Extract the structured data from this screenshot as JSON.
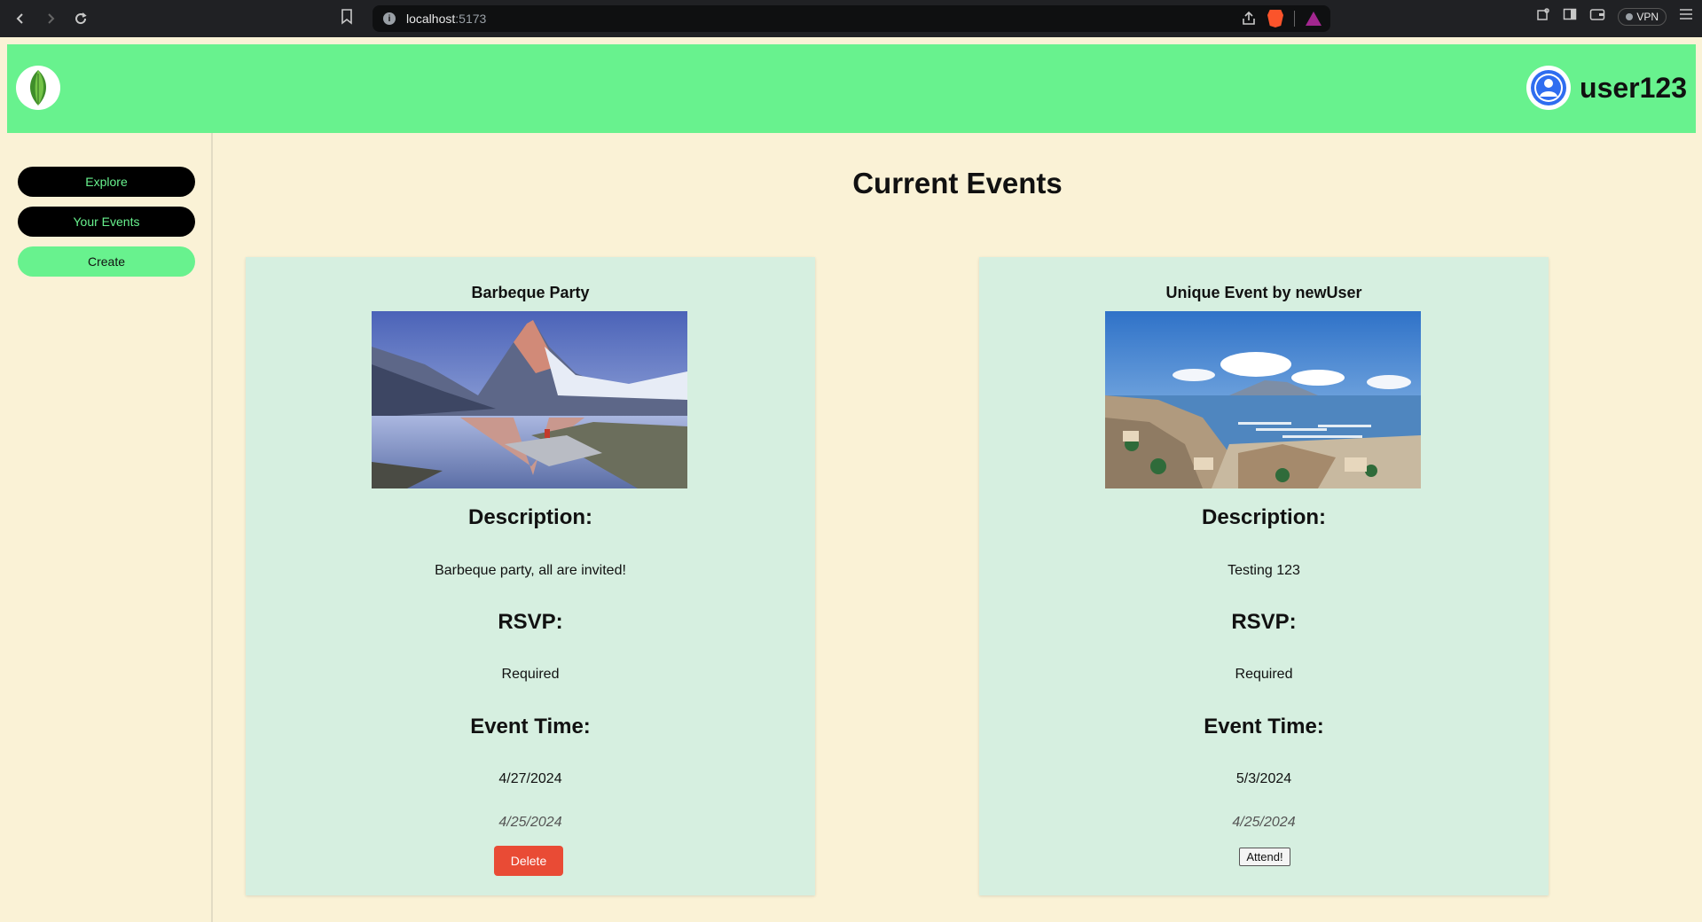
{
  "browser": {
    "url_host": "localhost",
    "url_port": ":5173",
    "vpn_label": "VPN"
  },
  "header": {
    "username": "user123"
  },
  "sidebar": {
    "items": [
      {
        "label": "Explore"
      },
      {
        "label": "Your Events"
      },
      {
        "label": "Create"
      }
    ]
  },
  "main": {
    "title": "Current Events",
    "events": [
      {
        "title": "Barbeque Party",
        "description_heading": "Description:",
        "description": "Barbeque party, all are invited!",
        "rsvp_heading": "RSVP:",
        "rsvp": "Required",
        "time_heading": "Event Time:",
        "time": "4/27/2024",
        "created": "4/25/2024",
        "action_label": "Delete"
      },
      {
        "title": "Unique Event by newUser",
        "description_heading": "Description:",
        "description": "Testing 123",
        "rsvp_heading": "RSVP:",
        "rsvp": "Required",
        "time_heading": "Event Time:",
        "time": "5/3/2024",
        "created": "4/25/2024",
        "action_label": "Attend!"
      }
    ]
  },
  "colors": {
    "header_green": "#68f28e",
    "page_bg": "#faf2d6",
    "card_bg": "#d6efe0",
    "delete_red": "#e94b35"
  }
}
